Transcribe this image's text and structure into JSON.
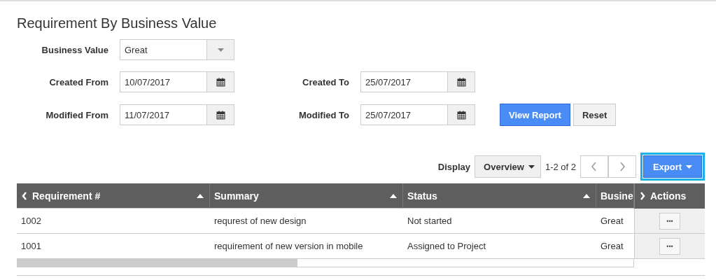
{
  "title": "Requirement By Business Value",
  "filters": [
    {
      "kind": "select",
      "label": "Business Value",
      "value": "Great"
    },
    {
      "kind": "date",
      "label": "Created From",
      "value": "10/07/2017"
    },
    {
      "kind": "date",
      "label": "Created To",
      "value": "25/07/2017"
    },
    {
      "kind": "date",
      "label": "Modified From",
      "value": "11/07/2017"
    },
    {
      "kind": "date",
      "label": "Modified To",
      "value": "25/07/2017"
    }
  ],
  "buttons": [
    {
      "label": "View Report",
      "primary": true
    },
    {
      "label": "Reset",
      "primary": false
    }
  ],
  "toolbar": {
    "display_label": "Display",
    "display_value": "Overview",
    "page_info": "1-2 of 2",
    "export": "Export",
    "export_focused": true
  },
  "table": {
    "columns": [
      {
        "label": "Requirement #",
        "sort_arrow": true,
        "collapse": true
      },
      {
        "label": "Summary",
        "sort_arrow": true,
        "collapse": false
      },
      {
        "label": "Status",
        "sort_arrow": true,
        "collapse": false
      },
      {
        "label": "Busine",
        "collapse": false
      }
    ],
    "actions_label": "Actions",
    "rows": [
      {
        "cells": [
          "1002",
          "requrest of new design",
          "Not started",
          "Great"
        ],
        "action": "•••"
      },
      {
        "cells": [
          "1001",
          "requirement of new version in mobile",
          "Assigned to Project",
          "Great"
        ],
        "action": "•••"
      }
    ]
  }
}
